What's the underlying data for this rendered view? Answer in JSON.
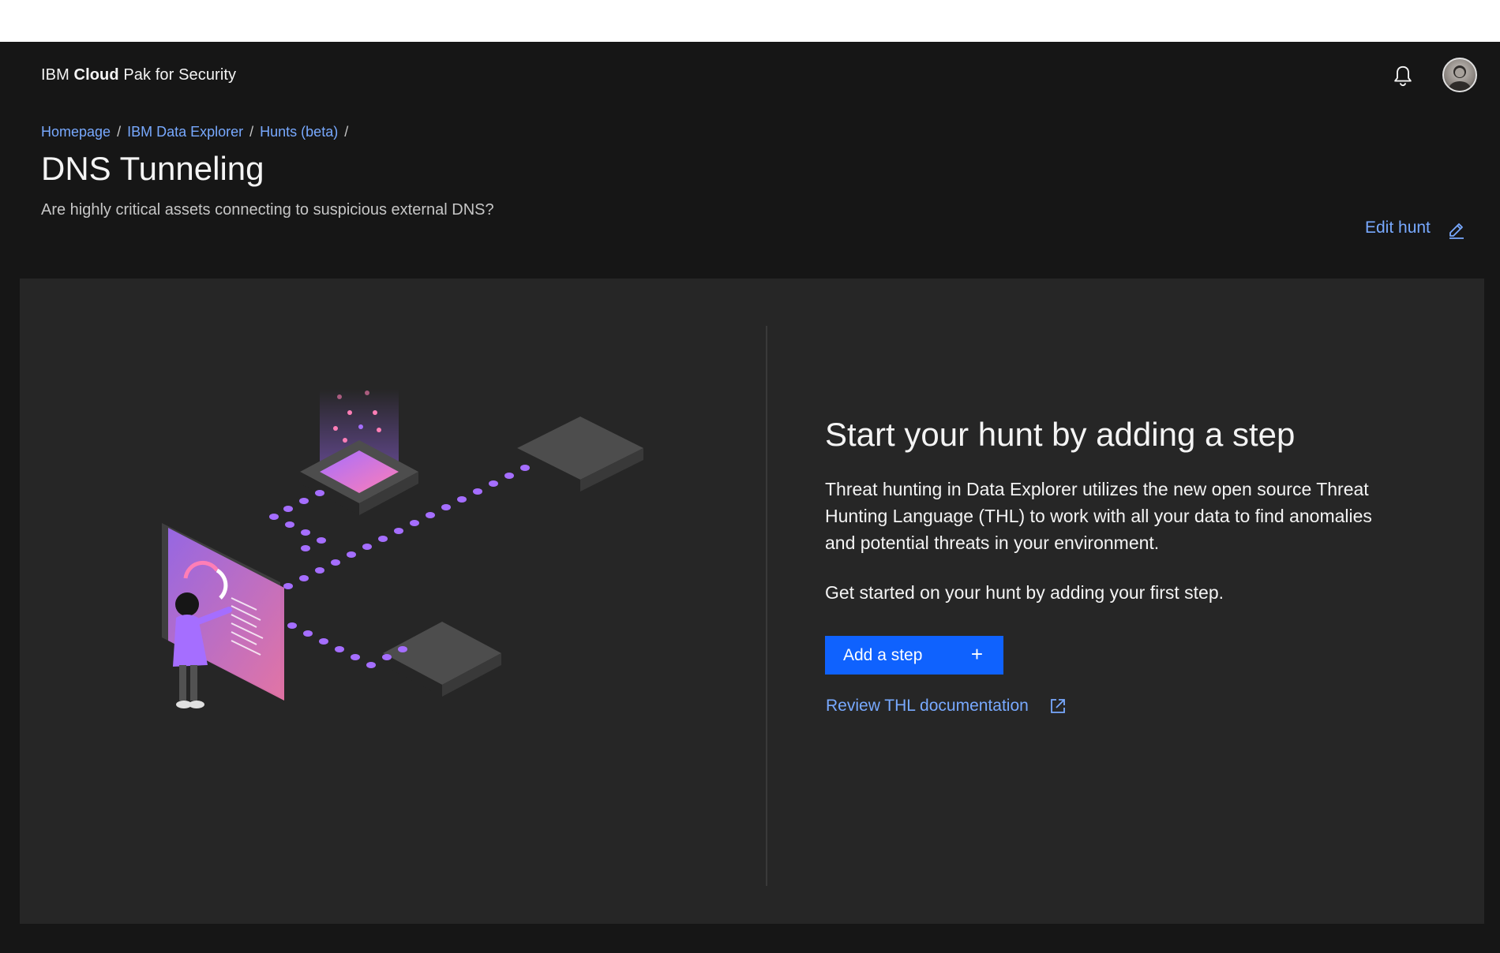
{
  "header": {
    "brand_prefix": "IBM",
    "brand_bold": "Cloud",
    "brand_suffix": "Pak for Security",
    "notification_icon": "bell-icon",
    "avatar_icon": "user-avatar"
  },
  "breadcrumb": {
    "items": [
      "Homepage",
      "IBM Data Explorer",
      "Hunts (beta)"
    ],
    "separator": "/"
  },
  "page": {
    "title": "DNS Tunneling",
    "subtitle": "Are highly critical assets connecting to suspicious external DNS?",
    "edit_label": "Edit hunt",
    "edit_icon": "edit-icon"
  },
  "empty_state": {
    "title": "Start your hunt by adding a step",
    "body": "Threat hunting in Data Explorer utilizes the new open source Threat Hunting Language (THL) to work with all your data to find anomalies and potential threats in your environment.",
    "body2": "Get started on your hunt by adding your first step.",
    "add_step_label": "Add a step",
    "add_step_icon": "+",
    "doc_link_label": "Review THL documentation",
    "doc_link_icon": "launch-icon"
  },
  "colors": {
    "background": "#161616",
    "panel": "#262626",
    "link": "#78a9ff",
    "primary_button": "#0f62fe"
  }
}
